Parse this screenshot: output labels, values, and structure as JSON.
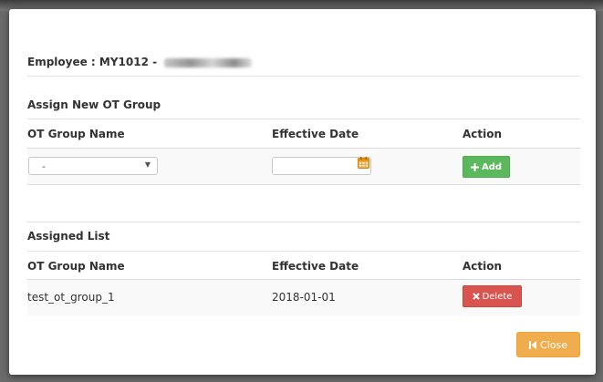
{
  "employee": {
    "label": "Employee : MY1012 - ",
    "name_redacted": true
  },
  "assign_section": {
    "title": "Assign New OT Group",
    "columns": [
      "OT Group Name",
      "Effective Date",
      "Action"
    ],
    "group_select": {
      "selected": "-",
      "arrow": "▼"
    },
    "effective_date": {
      "value": ""
    },
    "add_button": {
      "label": "Add",
      "icon": "plus-icon"
    }
  },
  "assigned_section": {
    "title": "Assigned List",
    "columns": [
      "OT Group Name",
      "Effective Date",
      "Action"
    ],
    "rows": [
      {
        "group_name": "test_ot_group_1",
        "effective_date": "2018-01-01",
        "action_label": "Delete",
        "action_icon": "x-icon"
      }
    ]
  },
  "footer": {
    "close_button": {
      "label": "Close",
      "icon": "step-backward-icon"
    }
  },
  "colors": {
    "add": "#5cb85c",
    "delete": "#d9534f",
    "close": "#f0ad4e",
    "calendar": "#f0ad4e"
  }
}
